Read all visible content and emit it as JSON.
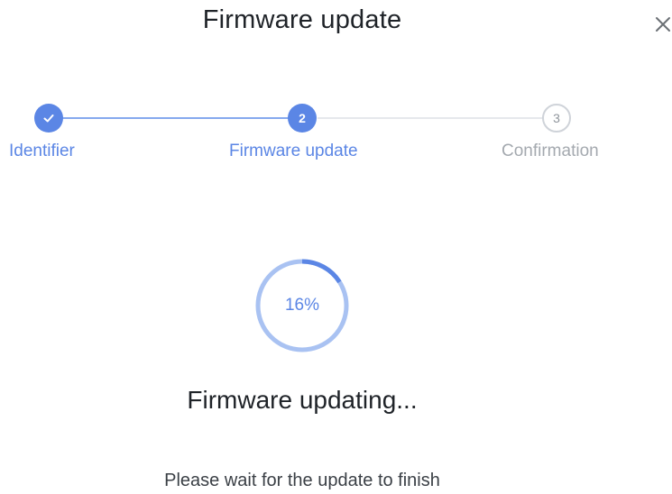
{
  "dialog": {
    "title": "Firmware update",
    "close_icon": "close-icon"
  },
  "stepper": {
    "steps": [
      {
        "label": "Identifier",
        "status": "completed",
        "marker": "check-icon"
      },
      {
        "label": "Firmware update",
        "status": "active",
        "marker": "2"
      },
      {
        "label": "Confirmation",
        "status": "pending",
        "marker": "3"
      }
    ],
    "colors": {
      "active": "#5b86e5",
      "completed_line": "#86a9ee",
      "pending": "#a4a9af"
    }
  },
  "progress": {
    "percent": 16,
    "label": "16%",
    "colors": {
      "track": "#a9c2f2",
      "fill": "#5b86e5"
    }
  },
  "status": {
    "title": "Firmware updating...",
    "subtitle": "Please wait for the update to finish"
  }
}
